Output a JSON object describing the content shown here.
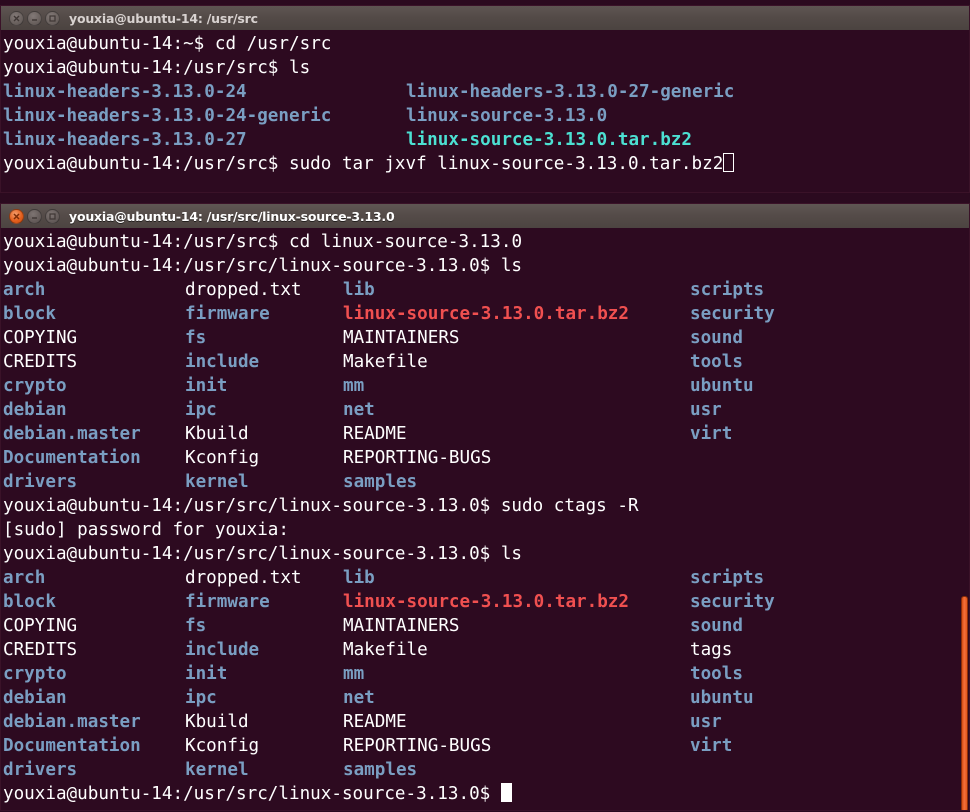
{
  "desktop": {
    "background": "#2b0a1f"
  },
  "colors": {
    "terminal_bg": "#2d0a20",
    "text": "#ffffff",
    "dir_blue": "#7a9ec2",
    "archive_red": "#f05050",
    "archive_cyan": "#4ce0d2",
    "titlebar_inactive": "#534a47",
    "titlebar_active": "#544b48",
    "close_orange": "#e4601e",
    "scrollbar_orange": "#e2561d"
  },
  "windows": [
    {
      "id": "terminal-upper",
      "focused": false,
      "title": "youxia@ubuntu-14: /usr/src",
      "buttons": [
        {
          "name": "close-button",
          "glyph": "✕"
        },
        {
          "name": "minimize-button",
          "glyph": "−"
        },
        {
          "name": "maximize-button",
          "glyph": "□"
        }
      ],
      "lines": [
        {
          "type": "prompt",
          "prompt": "youxia@ubuntu-14:~$ ",
          "command": "cd /usr/src"
        },
        {
          "type": "prompt",
          "prompt": "youxia@ubuntu-14:/usr/src$ ",
          "command": "ls"
        }
      ],
      "ls_columns_x": [
        0,
        403
      ],
      "ls_rows": [
        [
          {
            "text": "linux-headers-3.13.0-24",
            "kind": "dir"
          },
          {
            "text": "linux-headers-3.13.0-27-generic",
            "kind": "dir"
          }
        ],
        [
          {
            "text": "linux-headers-3.13.0-24-generic",
            "kind": "dir"
          },
          {
            "text": "linux-source-3.13.0",
            "kind": "dir"
          }
        ],
        [
          {
            "text": "linux-headers-3.13.0-27",
            "kind": "dir"
          },
          {
            "text": "linux-source-3.13.0.tar.bz2",
            "kind": "archive-cyan"
          }
        ]
      ],
      "last_line": {
        "prompt": "youxia@ubuntu-14:/usr/src$ ",
        "command": "sudo tar jxvf linux-source-3.13.0.tar.bz2",
        "cursor": "hollow"
      }
    },
    {
      "id": "terminal-lower",
      "focused": true,
      "title": "youxia@ubuntu-14: /usr/src/linux-source-3.13.0",
      "buttons": [
        {
          "name": "close-button",
          "glyph": "✕"
        },
        {
          "name": "minimize-button",
          "glyph": "−"
        },
        {
          "name": "maximize-button",
          "glyph": "□"
        }
      ],
      "header_lines": [
        {
          "prompt": "youxia@ubuntu-14:/usr/src$ ",
          "command": "cd linux-source-3.13.0"
        },
        {
          "prompt": "youxia@ubuntu-14:/usr/src/linux-source-3.13.0$ ",
          "command": "ls"
        }
      ],
      "ls_columns_x": [
        0,
        182,
        340,
        687
      ],
      "ls_rows_first": [
        [
          {
            "text": "arch",
            "kind": "dir"
          },
          {
            "text": "dropped.txt",
            "kind": "file"
          },
          {
            "text": "lib",
            "kind": "dir"
          },
          {
            "text": "scripts",
            "kind": "dir"
          }
        ],
        [
          {
            "text": "block",
            "kind": "dir"
          },
          {
            "text": "firmware",
            "kind": "dir"
          },
          {
            "text": "linux-source-3.13.0.tar.bz2",
            "kind": "archive-red"
          },
          {
            "text": "security",
            "kind": "dir"
          }
        ],
        [
          {
            "text": "COPYING",
            "kind": "file"
          },
          {
            "text": "fs",
            "kind": "dir"
          },
          {
            "text": "MAINTAINERS",
            "kind": "file"
          },
          {
            "text": "sound",
            "kind": "dir"
          }
        ],
        [
          {
            "text": "CREDITS",
            "kind": "file"
          },
          {
            "text": "include",
            "kind": "dir"
          },
          {
            "text": "Makefile",
            "kind": "file"
          },
          {
            "text": "tools",
            "kind": "dir"
          }
        ],
        [
          {
            "text": "crypto",
            "kind": "dir"
          },
          {
            "text": "init",
            "kind": "dir"
          },
          {
            "text": "mm",
            "kind": "dir"
          },
          {
            "text": "ubuntu",
            "kind": "dir"
          }
        ],
        [
          {
            "text": "debian",
            "kind": "dir"
          },
          {
            "text": "ipc",
            "kind": "dir"
          },
          {
            "text": "net",
            "kind": "dir"
          },
          {
            "text": "usr",
            "kind": "dir"
          }
        ],
        [
          {
            "text": "debian.master",
            "kind": "dir"
          },
          {
            "text": "Kbuild",
            "kind": "file"
          },
          {
            "text": "README",
            "kind": "file"
          },
          {
            "text": "virt",
            "kind": "dir"
          }
        ],
        [
          {
            "text": "Documentation",
            "kind": "dir"
          },
          {
            "text": "Kconfig",
            "kind": "file"
          },
          {
            "text": "REPORTING-BUGS",
            "kind": "file"
          }
        ],
        [
          {
            "text": "drivers",
            "kind": "dir"
          },
          {
            "text": "kernel",
            "kind": "dir"
          },
          {
            "text": "samples",
            "kind": "dir"
          }
        ]
      ],
      "middle_lines": [
        {
          "type": "prompt",
          "prompt": "youxia@ubuntu-14:/usr/src/linux-source-3.13.0$ ",
          "command": "sudo ctags -R"
        },
        {
          "type": "output",
          "text": "[sudo] password for youxia:"
        },
        {
          "type": "prompt",
          "prompt": "youxia@ubuntu-14:/usr/src/linux-source-3.13.0$ ",
          "command": "ls"
        }
      ],
      "ls_rows_second": [
        [
          {
            "text": "arch",
            "kind": "dir"
          },
          {
            "text": "dropped.txt",
            "kind": "file"
          },
          {
            "text": "lib",
            "kind": "dir"
          },
          {
            "text": "scripts",
            "kind": "dir"
          }
        ],
        [
          {
            "text": "block",
            "kind": "dir"
          },
          {
            "text": "firmware",
            "kind": "dir"
          },
          {
            "text": "linux-source-3.13.0.tar.bz2",
            "kind": "archive-red"
          },
          {
            "text": "security",
            "kind": "dir"
          }
        ],
        [
          {
            "text": "COPYING",
            "kind": "file"
          },
          {
            "text": "fs",
            "kind": "dir"
          },
          {
            "text": "MAINTAINERS",
            "kind": "file"
          },
          {
            "text": "sound",
            "kind": "dir"
          }
        ],
        [
          {
            "text": "CREDITS",
            "kind": "file"
          },
          {
            "text": "include",
            "kind": "dir"
          },
          {
            "text": "Makefile",
            "kind": "file"
          },
          {
            "text": "tags",
            "kind": "file"
          }
        ],
        [
          {
            "text": "crypto",
            "kind": "dir"
          },
          {
            "text": "init",
            "kind": "dir"
          },
          {
            "text": "mm",
            "kind": "dir"
          },
          {
            "text": "tools",
            "kind": "dir"
          }
        ],
        [
          {
            "text": "debian",
            "kind": "dir"
          },
          {
            "text": "ipc",
            "kind": "dir"
          },
          {
            "text": "net",
            "kind": "dir"
          },
          {
            "text": "ubuntu",
            "kind": "dir"
          }
        ],
        [
          {
            "text": "debian.master",
            "kind": "dir"
          },
          {
            "text": "Kbuild",
            "kind": "file"
          },
          {
            "text": "README",
            "kind": "file"
          },
          {
            "text": "usr",
            "kind": "dir"
          }
        ],
        [
          {
            "text": "Documentation",
            "kind": "dir"
          },
          {
            "text": "Kconfig",
            "kind": "file"
          },
          {
            "text": "REPORTING-BUGS",
            "kind": "file"
          },
          {
            "text": "virt",
            "kind": "dir"
          }
        ],
        [
          {
            "text": "drivers",
            "kind": "dir"
          },
          {
            "text": "kernel",
            "kind": "dir"
          },
          {
            "text": "samples",
            "kind": "dir"
          }
        ]
      ],
      "last_line": {
        "prompt": "youxia@ubuntu-14:/usr/src/linux-source-3.13.0$ ",
        "command": "",
        "cursor": "solid"
      },
      "scrollbar": {
        "thumb_top_pct": 63,
        "thumb_height_pct": 37
      }
    }
  ]
}
